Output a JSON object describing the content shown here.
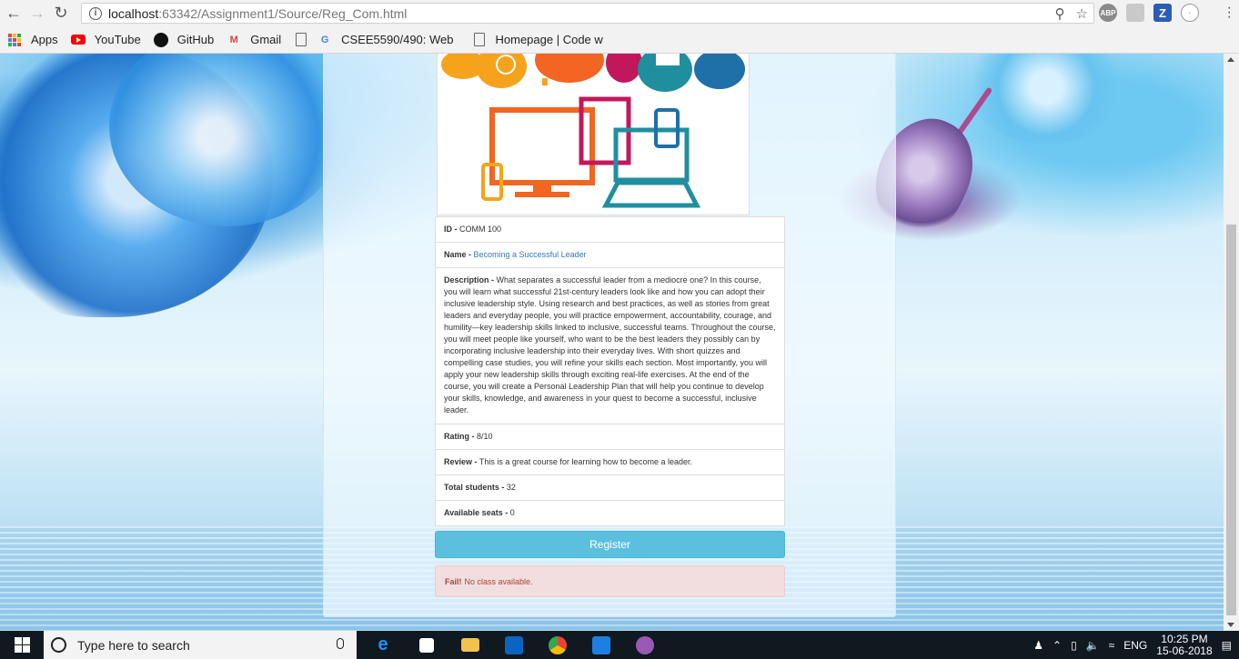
{
  "browser": {
    "url_host": "localhost",
    "url_rest": ":63342/Assignment1/Source/Reg_Com.html",
    "bookmarks": [
      {
        "label": "Apps",
        "icon": "apps-grid-icon"
      },
      {
        "label": "YouTube",
        "icon": "youtube-icon"
      },
      {
        "label": "GitHub",
        "icon": "github-icon"
      },
      {
        "label": "Gmail",
        "icon": "gmail-icon"
      },
      {
        "label": "",
        "icon": "document-icon"
      },
      {
        "label": "CSEE5590/490: Web",
        "icon": "google-icon"
      },
      {
        "label": "Homepage | Code w",
        "icon": "document-icon"
      }
    ]
  },
  "course": {
    "id_label": "ID -",
    "id_value": "COMM 100",
    "name_label": "Name -",
    "name_value": "Becoming a Successful Leader",
    "description_label": "Description -",
    "description_value": "What separates a successful leader from a mediocre one? In this course, you will learn what successful 21st-century leaders look like and how you can adopt their inclusive leadership style. Using research and best practices, as well as stories from great leaders and everyday people, you will practice empowerment, accountability, courage, and humility—key leadership skills linked to inclusive, successful teams. Throughout the course, you will meet people like yourself, who want to be the best leaders they possibly can by incorporating inclusive leadership into their everyday lives. With short quizzes and compelling case studies, you will refine your skills each section. Most importantly, you will apply your new leadership skills through exciting real-life exercises. At the end of the course, you will create a Personal Leadership Plan that will help you continue to develop your skills, knowledge, and awareness in your quest to become a successful, inclusive leader.",
    "rating_label": "Rating -",
    "rating_value": "8/10",
    "review_label": "Review -",
    "review_value": "This is a great course for learning how to become a leader.",
    "total_students_label": "Total students -",
    "total_students_value": "32",
    "available_seats_label": "Available seats -",
    "available_seats_value": "0"
  },
  "actions": {
    "register_label": "Register"
  },
  "alert": {
    "strong": "Fail!",
    "message": "No class available."
  },
  "taskbar": {
    "search_placeholder": "Type here to search",
    "language": "ENG",
    "time": "10:25 PM",
    "date": "15-06-2018"
  }
}
